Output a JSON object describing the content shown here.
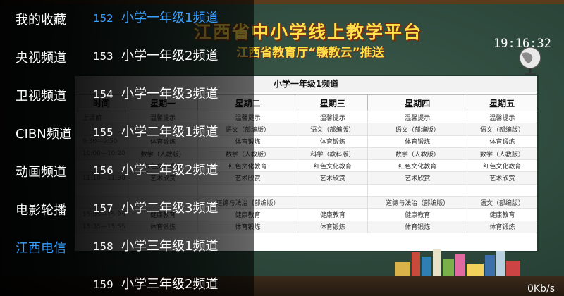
{
  "categories": [
    {
      "label": "我的收藏",
      "active": false
    },
    {
      "label": "央视频道",
      "active": false
    },
    {
      "label": "卫视频道",
      "active": false
    },
    {
      "label": "CIBN频道",
      "active": false
    },
    {
      "label": "动画频道",
      "active": false
    },
    {
      "label": "电影轮播",
      "active": false
    },
    {
      "label": "江西电信",
      "active": true
    }
  ],
  "channels": [
    {
      "number": "152",
      "name": "小学一年级1频道",
      "active": true
    },
    {
      "number": "153",
      "name": "小学一年级2频道",
      "active": false
    },
    {
      "number": "154",
      "name": "小学一年级3频道",
      "active": false
    },
    {
      "number": "155",
      "name": "小学二年级1频道",
      "active": false
    },
    {
      "number": "156",
      "name": "小学二年级2频道",
      "active": false
    },
    {
      "number": "157",
      "name": "小学二年级3频道",
      "active": false
    },
    {
      "number": "158",
      "name": "小学三年级1频道",
      "active": false
    },
    {
      "number": "159",
      "name": "小学三年级2频道",
      "active": false
    }
  ],
  "video": {
    "banner_title": "江西省中小学线上教学平台",
    "banner_subtitle": "江西省教育厅“赣教云”推送",
    "clock": "19:16:32",
    "schedule": {
      "title": "小学一年级1频道",
      "headers": [
        "时间",
        "星期一",
        "星期二",
        "星期三",
        "星期四",
        "星期五"
      ],
      "rows": [
        [
          "上课前",
          "温馨提示",
          "温馨提示",
          "温馨提示",
          "温馨提示",
          "温馨提示"
        ],
        [
          "",
          "",
          "语文（部编版）",
          "语文（部编版）",
          "语文（部编版）",
          "语文（部编版）"
        ],
        [
          "9:30—9:50",
          "体育锻炼",
          "体育锻炼",
          "体育锻炼",
          "体育锻炼",
          "体育锻炼"
        ],
        [
          "10:00—10:20",
          "数学（人教版）",
          "数学（人教版）",
          "科学（教科版）",
          "数学（人教版）",
          "数学（人教版）"
        ],
        [
          "",
          "红色文化教育",
          "红色文化教育",
          "红色文化教育",
          "红色文化教育",
          "红色文化教育"
        ],
        [
          "11:10—11:30",
          "艺术欣赏",
          "艺术欣赏",
          "艺术欣赏",
          "艺术欣赏",
          "艺术欣赏"
        ],
        [
          "",
          "",
          "",
          "",
          "",
          ""
        ],
        [
          "",
          "",
          "道德与法治（部编版）",
          "",
          "道德与法治（部编版）",
          "语文（部编版）"
        ],
        [
          "15:05—15:25",
          "健康教育",
          "健康教育",
          "健康教育",
          "健康教育",
          "健康教育"
        ],
        [
          "15:35—15:55",
          "体育锻炼",
          "体育锻炼",
          "体育锻炼",
          "体育锻炼",
          "体育锻炼"
        ]
      ]
    }
  },
  "status": {
    "net_speed": "0Kb/s"
  }
}
